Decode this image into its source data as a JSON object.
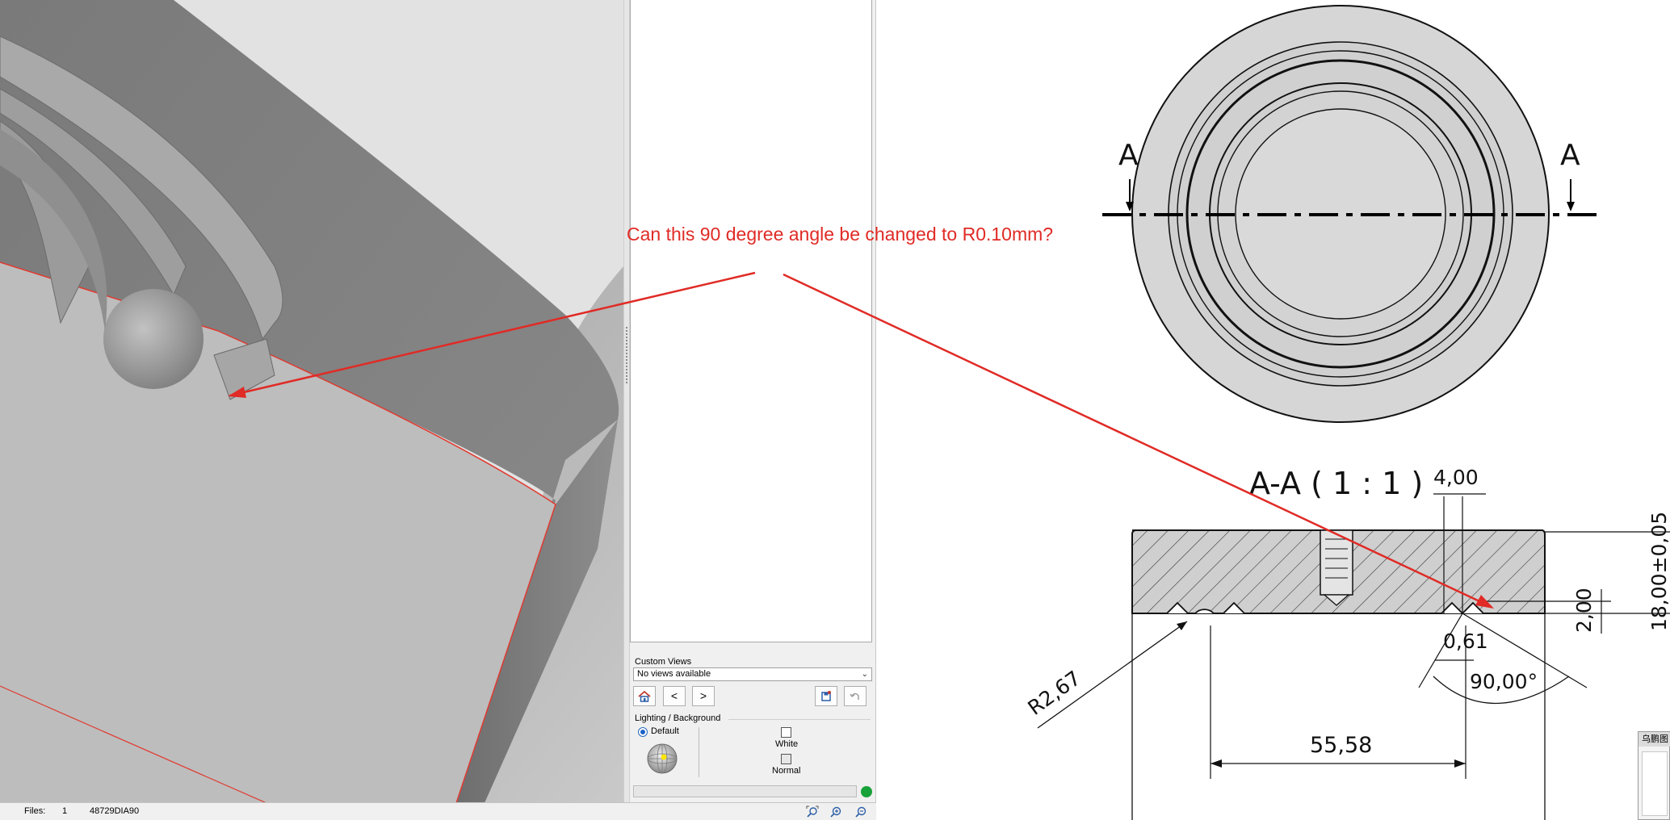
{
  "side_panel": {
    "custom_views_label": "Custom Views",
    "views_select_value": "No views available",
    "prev_label": "<",
    "next_label": ">",
    "lighting_title": "Lighting / Background",
    "default_label": "Default",
    "white_label": "White",
    "normal_label": "Normal"
  },
  "status_bar": {
    "files_label": "Files:",
    "files_count": "1",
    "file_name": "48729DIA90"
  },
  "annotation": {
    "text": "Can this 90 degree angle be changed to R0.10mm?",
    "color": "#e02b26"
  },
  "drawing": {
    "section_label_left": "A",
    "section_label_right": "A",
    "section_title": "A-A ( 1 : 1 )",
    "dim_4": "4,00",
    "dim_height": "18,00±0,05",
    "dim_2": "2,00",
    "dim_061": "0,61",
    "dim_angle": "90,00°",
    "dim_radius": "R2,67",
    "dim_5558": "55,58"
  },
  "ime_widget": {
    "title": "乌鹏图"
  }
}
